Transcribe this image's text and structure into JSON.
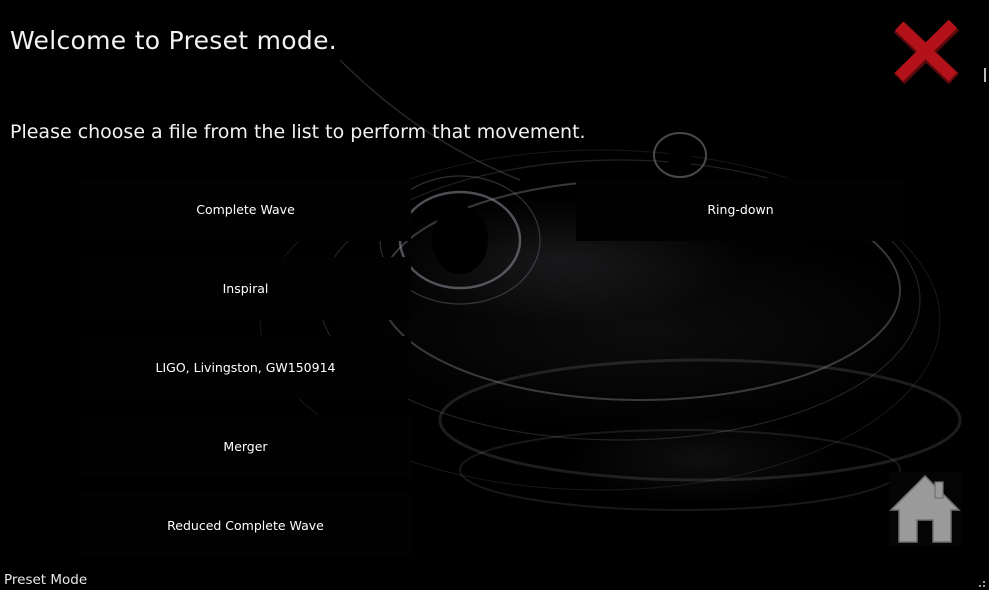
{
  "window": {
    "title": "Welcome to Preset mode.",
    "subtitle": "Please choose a file from the list to perform that movement."
  },
  "files": [
    {
      "label": "Complete Wave"
    },
    {
      "label": "Inspiral"
    },
    {
      "label": "LIGO, Livingston, GW150914"
    },
    {
      "label": "Merger"
    },
    {
      "label": "Reduced Complete Wave"
    },
    {
      "label": "Ring-down"
    }
  ],
  "status": {
    "mode_label": "Preset Mode"
  },
  "icons": {
    "close": "close-icon",
    "home": "home-icon",
    "resize_grip": "resize-grip-icon"
  },
  "colors": {
    "background": "#000000",
    "close_red": "#b3121b",
    "home_gray": "#9a9a9a",
    "button_bg": "#020202",
    "text": "#f2f2f2"
  }
}
